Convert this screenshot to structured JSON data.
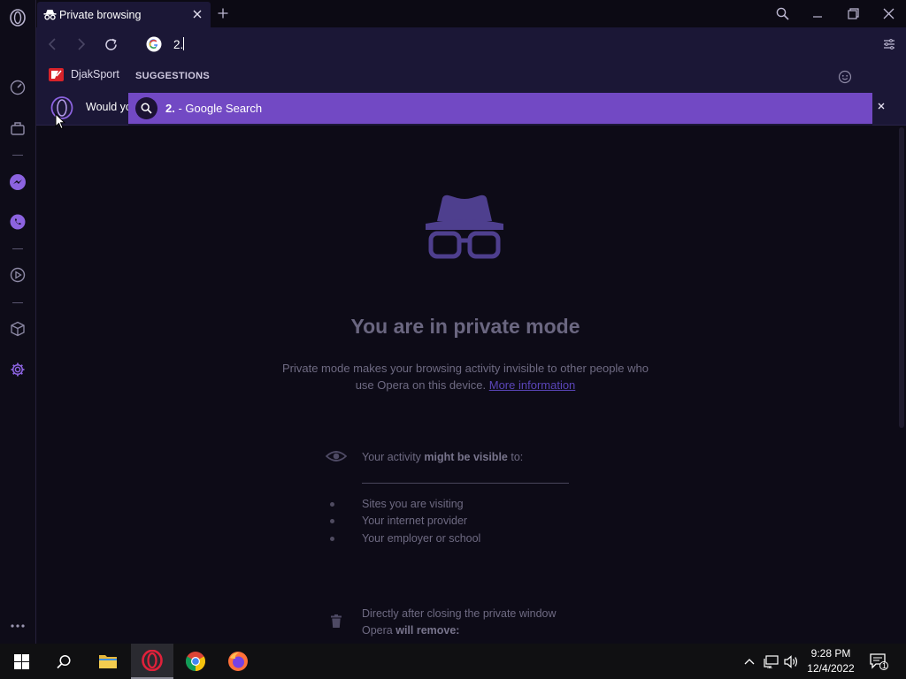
{
  "browser": {
    "tab": {
      "title": "Private browsing"
    },
    "address_bar": {
      "value": "2."
    },
    "bookmarks": [
      {
        "label": "DjakSport"
      }
    ],
    "infobar": {
      "text": "Would yo"
    }
  },
  "suggestions": {
    "header": "SUGGESTIONS",
    "items": [
      {
        "query": "2.",
        "suffix": " - Google Search"
      }
    ]
  },
  "private_page": {
    "title": "You are in private mode",
    "description": "Private mode makes your browsing activity invisible to other people who use Opera on this device.",
    "more_info_link": "More information",
    "visible_to_prefix": "Your activity ",
    "visible_to_bold": "might be visible",
    "visible_to_suffix": " to:",
    "visible_list": [
      "Sites you are visiting",
      "Your internet provider",
      "Your employer or school"
    ],
    "remove_line1": "Directly after closing the private window",
    "remove_line2_prefix": "Opera ",
    "remove_line2_bold": "will remove:"
  },
  "taskbar": {
    "time": "9:28 PM",
    "date": "12/4/2022",
    "notification_count": "1"
  },
  "colors": {
    "accent": "#7249c4",
    "toolbar": "#1b1736",
    "page_bg": "#0d0b17"
  }
}
